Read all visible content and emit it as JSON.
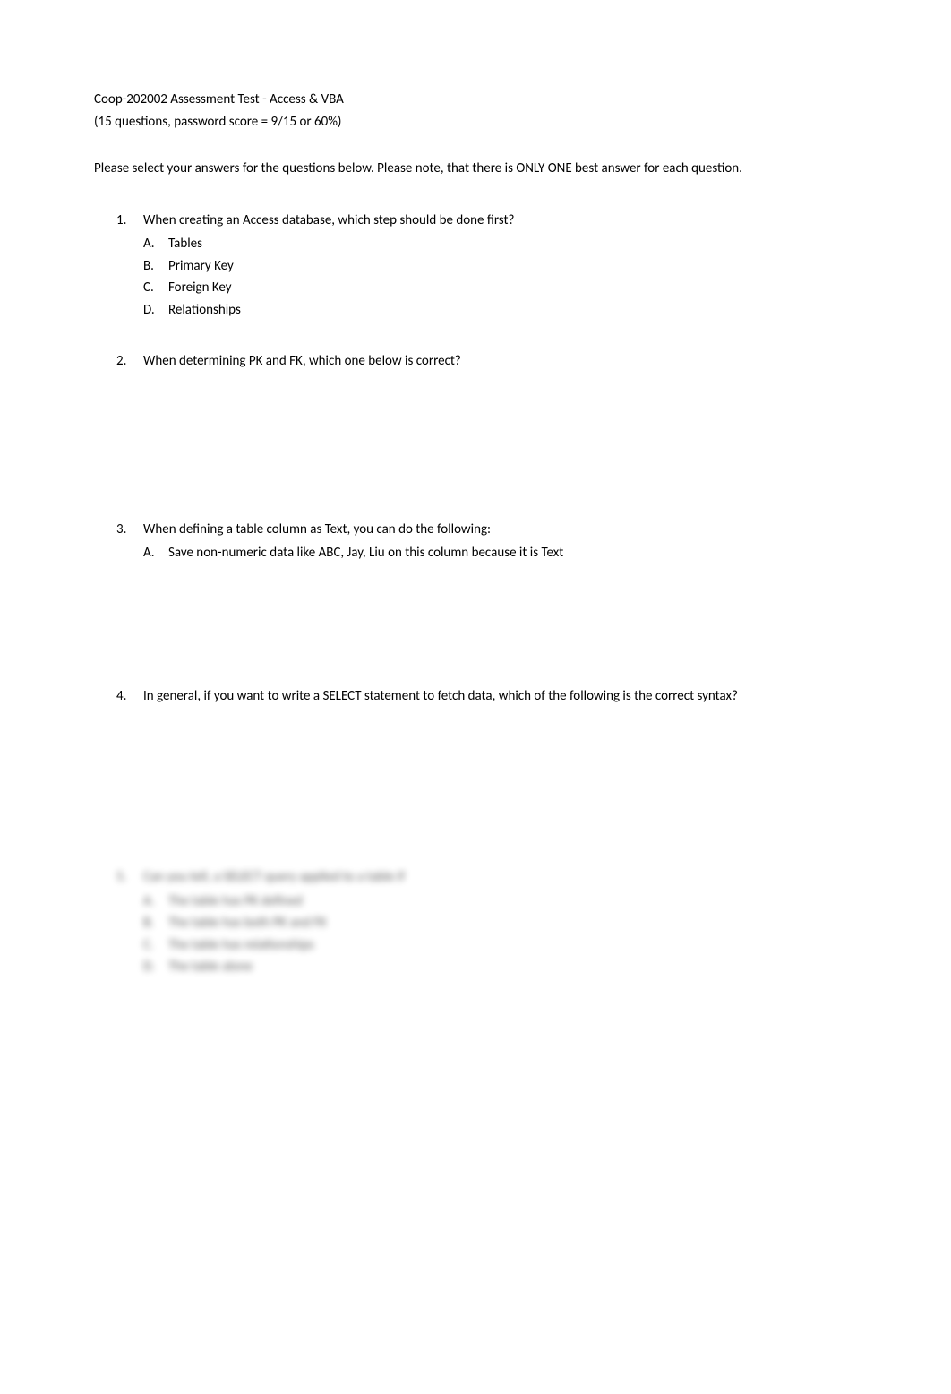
{
  "header": {
    "line1": "Coop-202002 Assessment Test - Access & VBA",
    "line2": "(15 questions, password score = 9/15 or 60%)"
  },
  "intro": "Please select your answers for the questions below. Please note, that there is ONLY ONE best answer for each question.",
  "questions": [
    {
      "number": "1.",
      "text": "When creating an Access database, which step should be done first?",
      "options": [
        {
          "letter": "A.",
          "text": "Tables"
        },
        {
          "letter": "B.",
          "text": "Primary Key"
        },
        {
          "letter": "C.",
          "text": "Foreign Key"
        },
        {
          "letter": "D.",
          "text": "Relationships"
        }
      ]
    },
    {
      "number": "2.",
      "text": "When determining PK and FK, which one below is correct?",
      "options": []
    },
    {
      "number": "3.",
      "text": "When defining a table column as Text, you can do the following:",
      "options": [
        {
          "letter": "A.",
          "text": "Save non-numeric data like ABC, Jay, Liu on this column because it is Text"
        }
      ]
    },
    {
      "number": "4.",
      "text": "In general, if you want to write a SELECT statement to fetch data, which of the following is the correct syntax?",
      "options": []
    }
  ],
  "blurred": {
    "number": "5.",
    "text": "Can you tell, a SELECT query applied to a table if",
    "options": [
      {
        "letter": "A.",
        "text": "The table has PK defined"
      },
      {
        "letter": "B.",
        "text": "The table has both PK and FK"
      },
      {
        "letter": "C.",
        "text": "The table has relationships"
      },
      {
        "letter": "D.",
        "text": "The table alone"
      }
    ]
  }
}
